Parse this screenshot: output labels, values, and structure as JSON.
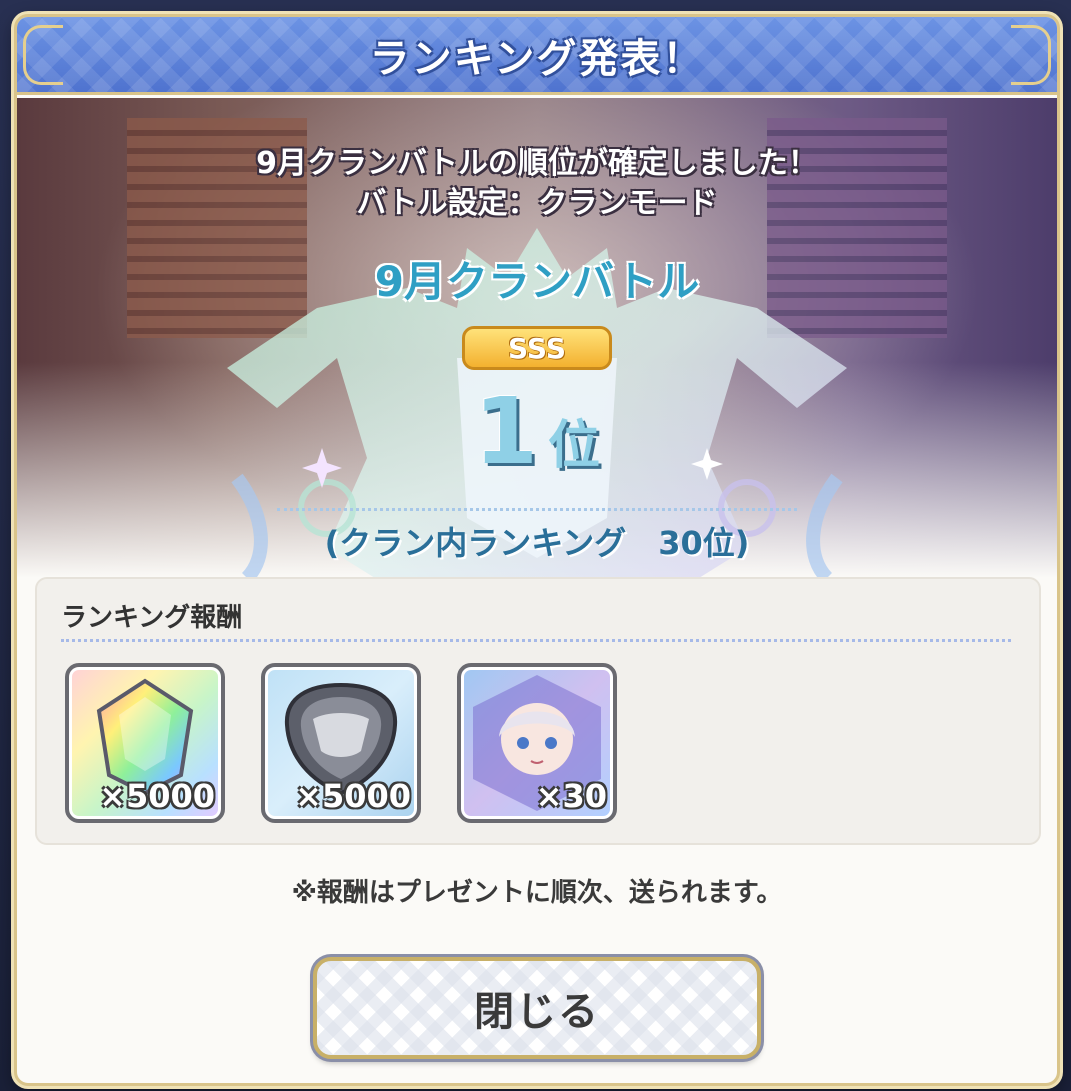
{
  "header": {
    "title": "ランキング発表！"
  },
  "hero": {
    "line1": "9月クランバトルの順位が確定しました！",
    "line2": "バトル設定：クランモード",
    "battle_name": "9月クランバトル",
    "grade": "SSS",
    "rank_number": "1",
    "rank_unit": "位",
    "clan_ranking": "(クラン内ランキング　30位)"
  },
  "rewards": {
    "title": "ランキング報酬",
    "items": [
      {
        "icon": "rainbow-jewel-icon",
        "quantity": "×5000"
      },
      {
        "icon": "clan-coin-icon",
        "quantity": "×5000"
      },
      {
        "icon": "character-memory-piece-icon",
        "quantity": "×30"
      }
    ]
  },
  "notice": "※報酬はプレゼントに順次、送られます。",
  "close_button": {
    "label": "閉じる"
  },
  "colors": {
    "header_blue": "#5a7fd8",
    "gold_border": "#d9c48a",
    "battle_name": "#2f9fc4",
    "rank_text": "#8fd0e6",
    "clan_rank_text": "#2a6f99",
    "grade_gold": "#f3b12f"
  }
}
